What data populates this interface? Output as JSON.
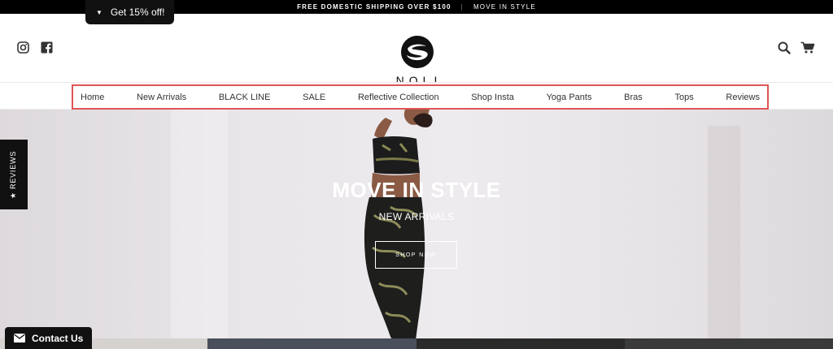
{
  "announcement": {
    "left": "FREE DOMESTIC SHIPPING OVER $100",
    "separator": "|",
    "right": "MOVE IN STYLE"
  },
  "discount_tab": {
    "label": "Get 15% off!",
    "icon": "caret-down-icon"
  },
  "header": {
    "brand": "NOLI",
    "social_icons": [
      "instagram-icon",
      "facebook-icon"
    ],
    "right_icons": [
      "search-icon",
      "cart-icon"
    ]
  },
  "nav": {
    "items": [
      {
        "label": "Home"
      },
      {
        "label": "New Arrivals"
      },
      {
        "label": "BLACK LINE"
      },
      {
        "label": "SALE"
      },
      {
        "label": "Reflective Collection"
      },
      {
        "label": "Shop Insta"
      },
      {
        "label": "Yoga Pants"
      },
      {
        "label": "Bras"
      },
      {
        "label": "Tops"
      },
      {
        "label": "Reviews"
      }
    ],
    "highlight_color": "#e05555"
  },
  "hero": {
    "title": "MOVE IN STYLE",
    "subtitle": "NEW ARRIVALS",
    "cta": "SHOP NOW"
  },
  "reviews_tab": {
    "label": "★ REVIEWS"
  },
  "contact": {
    "label": "Contact Us",
    "icon": "envelope-icon"
  }
}
